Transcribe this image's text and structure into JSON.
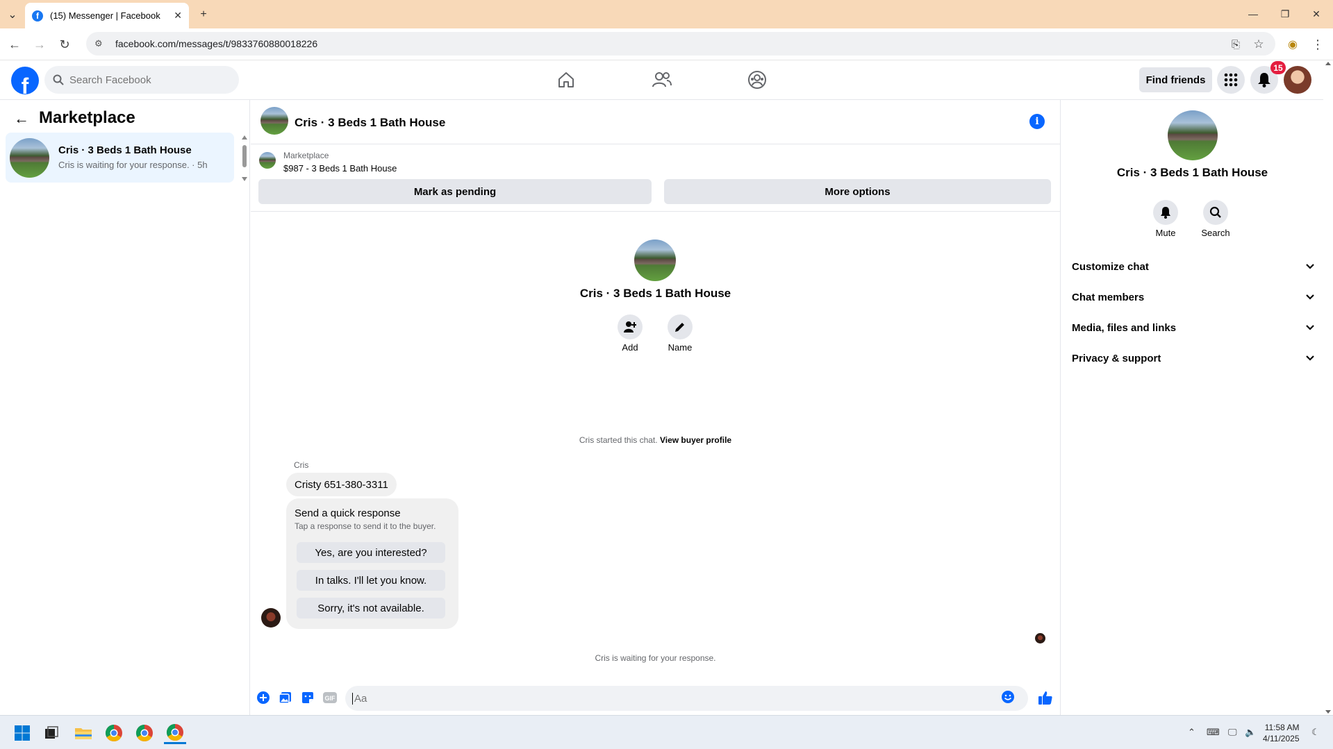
{
  "browser": {
    "tab_title": "(15) Messenger | Facebook",
    "url": "facebook.com/messages/t/9833760880018226"
  },
  "header": {
    "search_placeholder": "Search Facebook",
    "find_friends": "Find friends",
    "notification_count": "15"
  },
  "left": {
    "title": "Marketplace",
    "conversation": {
      "name": "Cris · 3 Beds 1 Bath House",
      "preview": "Cris is waiting for your response. · 5h"
    }
  },
  "chat": {
    "title": "Cris · 3 Beds 1 Bath House",
    "listing_label": "Marketplace",
    "listing_price": "$987 - 3 Beds 1 Bath House",
    "mark_pending": "Mark as pending",
    "more_options": "More options",
    "center_name": "Cris · 3 Beds 1 Bath House",
    "add_label": "Add",
    "name_label": "Name",
    "started_text": "Cris started this chat.",
    "view_buyer": "View buyer profile",
    "sender": "Cris",
    "message": "Cristy 651-380-3311",
    "quick_title": "Send a quick response",
    "quick_sub": "Tap a response to send it to the buyer.",
    "quick_options": [
      "Yes, are you interested?",
      "In talks. I'll let you know.",
      "Sorry, it's not available."
    ],
    "waiting": "Cris is waiting for your response.",
    "input_placeholder": "Aa"
  },
  "right": {
    "name": "Cris · 3 Beds 1 Bath House",
    "mute": "Mute",
    "search": "Search",
    "sections": [
      "Customize chat",
      "Chat members",
      "Media, files and links",
      "Privacy & support"
    ]
  },
  "taskbar": {
    "time": "11:58 AM",
    "date": "4/11/2025"
  },
  "colors": {
    "accent": "#0866ff",
    "tabstrip": "#f8d9b8",
    "selected_conversation": "#ebf5ff",
    "badge": "#e41e3f"
  }
}
